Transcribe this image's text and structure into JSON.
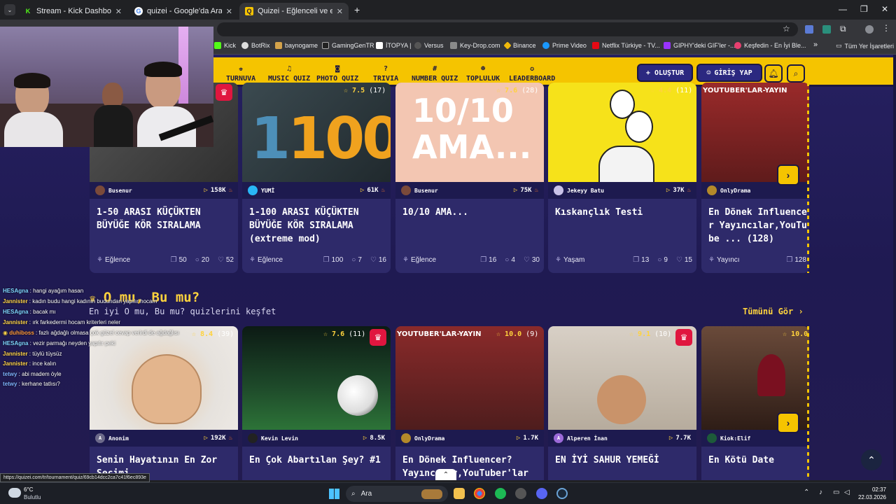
{
  "browser": {
    "tabs": [
      {
        "title": "Stream - Kick Dashboard",
        "favicon": "K",
        "color": "#53fc18",
        "active": false
      },
      {
        "title": "quizei - Google'da Ara",
        "favicon": "G",
        "color": "#ffffff",
        "active": false
      },
      {
        "title": "Quizei - Eğlenceli ve etkileşimli",
        "favicon": "Q",
        "color": "#f5c400",
        "active": true
      }
    ],
    "new_tab": "+",
    "bookmarks": [
      "Kick",
      "BotRix",
      "baynogame",
      "GamingGenTR",
      "İTOPYA |",
      "Versus",
      "Key-Drop.com",
      "Binance",
      "Prime Video",
      "Netflix Türkiye - TV...",
      "GIPHY'deki GIF'ler -...",
      "Keşfedin - En İyi Ble..."
    ],
    "bookmarks_more": "»",
    "all_bookmarks": "Tüm Yer İşaretleri",
    "status_url": "https://quizei.com/tr/tournament/quiz/69cb14dcc2ca7c41f6ec893e"
  },
  "nav": {
    "items": [
      {
        "label": "TURNUVA",
        "icon": "trophy-icon",
        "glyph": "♚"
      },
      {
        "label": "MUSIC QUIZ",
        "icon": "music-icon",
        "glyph": "♫"
      },
      {
        "label": "PHOTO QUIZ",
        "icon": "camera-icon",
        "glyph": "◙"
      },
      {
        "label": "TRIVIA",
        "icon": "question-icon",
        "glyph": "?"
      },
      {
        "label": "NUMBER QUIZ",
        "icon": "hash-icon",
        "glyph": "#"
      },
      {
        "label": "TOPLULUK",
        "icon": "users-icon",
        "glyph": "☻"
      },
      {
        "label": "LEADERBOARD",
        "icon": "medal-icon",
        "glyph": "✪"
      }
    ],
    "create_label": "+ OLUŞTUR",
    "login_label": "GİRİŞ YAP"
  },
  "row1": [
    {
      "rating": "",
      "count": "",
      "crown": true,
      "author": "Busenur",
      "plays": "158K",
      "title": "1-50 ARASI KÜÇÜKTEN BÜYÜĞE KÖR SIRALAMA",
      "category": "Eğlence",
      "questions": "50",
      "comments": "20",
      "likes": "52",
      "thumb": "#3a3a3a"
    },
    {
      "rating": "7.5",
      "count": "(17)",
      "crown": false,
      "author": "YUMİ",
      "plays": "61K",
      "title": "1-100 ARASI KÜÇÜKTEN BÜYÜĞE KÖR SIRALAMA (extreme mod)",
      "category": "Eğlence",
      "questions": "100",
      "comments": "7",
      "likes": "16",
      "thumb": "#2b3338",
      "thumb_text": "1100"
    },
    {
      "rating": "7.6",
      "count": "(28)",
      "crown": false,
      "author": "Busenur",
      "plays": "75K",
      "title": "10/10 AMA...",
      "category": "Eğlence",
      "questions": "16",
      "comments": "4",
      "likes": "30",
      "thumb": "#f5c9b5",
      "thumb_text": "10/10 AMA..."
    },
    {
      "rating": "4.4",
      "count": "(11)",
      "crown": false,
      "author": "Jekeyy Batu",
      "plays": "37K",
      "title": "Kıskançlık Testi",
      "category": "Yaşam",
      "questions": "13",
      "comments": "9",
      "likes": "15",
      "thumb": "#f7e51a"
    },
    {
      "rating": "",
      "count": "",
      "crown": false,
      "author": "OnlyDrama",
      "plays": "",
      "title": "En Dönek Influencer Yayıncılar,YouTube ... (128)",
      "category": "Yayıncı",
      "questions": "128",
      "comments": "",
      "likes": "",
      "thumb": "#7a2a2a",
      "thumb_text": "YOUTUBER'LAR-YAYIN"
    }
  ],
  "section2": {
    "title": "O mu, Bu mu?",
    "subtitle": "En iyi O mu, Bu mu? quizlerini keşfet",
    "see_all": "Tümünü Gör ›"
  },
  "row2": [
    {
      "rating": "8.4",
      "count": "(39)",
      "crown": false,
      "author": "Anonim",
      "plays": "192K",
      "title": "Senin Hayatının En Zor Seçimi",
      "thumb": "#e8e4df",
      "fire": true
    },
    {
      "rating": "7.6",
      "count": "(11)",
      "crown": true,
      "author": "Kevin Levin",
      "plays": "8.5K",
      "title": "En Çok Abartılan Şey? #1",
      "thumb": "#1f5a2a",
      "fire": false
    },
    {
      "rating": "10.0",
      "count": "(9)",
      "crown": false,
      "author": "OnlyDrama",
      "plays": "1.7K",
      "title": "En Dönek Influencer? Yayıncılar,YouTuber'lar",
      "thumb": "#6a2626",
      "thumb_text": "YOUTUBER'LAR-YAYIN",
      "fire": false
    },
    {
      "rating": "9.1",
      "count": "(10)",
      "crown": true,
      "author": "Alperen İnan",
      "plays": "7.7K",
      "title": "EN İYİ SAHUR YEMEĞİ",
      "thumb": "#cfc6b8",
      "fire": false
    },
    {
      "rating": "10.0",
      "count": "",
      "crown": false,
      "author": "Kiok:Elif",
      "plays": "",
      "title": "En Kötü Date",
      "thumb": "#5a3a2a",
      "fire": false
    }
  ],
  "chat": [
    {
      "user": "HESAgna",
      "color": "#7fd6ff",
      "msg": "hangi ayağım hasan"
    },
    {
      "user": "Jannister",
      "color": "#ffd54a",
      "msg": "kadın budu hangi kadının budundan yapılır hocam"
    },
    {
      "user": "HESAgna",
      "color": "#7fd6ff",
      "msg": "bacak mı"
    },
    {
      "user": "Jannister",
      "color": "#ffd54a",
      "msg": "ırk farkedermi hocam kriterleri neler"
    },
    {
      "user": "duhiboss",
      "color": "#ff9a3c",
      "msg": "fazlı ağdağlı olmasa çok güzel cevap verirdi de ağdağlısı"
    },
    {
      "user": "HESAgna",
      "color": "#7fd6ff",
      "msg": "vezir parmağı neyden yapılır peki"
    },
    {
      "user": "Jannister",
      "color": "#ffd54a",
      "msg": "tüylü tüysüz"
    },
    {
      "user": "Jannister",
      "color": "#ffd54a",
      "msg": "ince kalın"
    },
    {
      "user": "tetwy",
      "color": "#7fb4ff",
      "msg": "abi madem öyle"
    },
    {
      "user": "tetwy",
      "color": "#7fb4ff",
      "msg": "kerhane tatlısı?"
    }
  ],
  "taskbar": {
    "weather_temp": "6°C",
    "weather_desc": "Bulutlu",
    "search_label": "Ara",
    "time": "02:37",
    "date": "22.03.2026"
  }
}
